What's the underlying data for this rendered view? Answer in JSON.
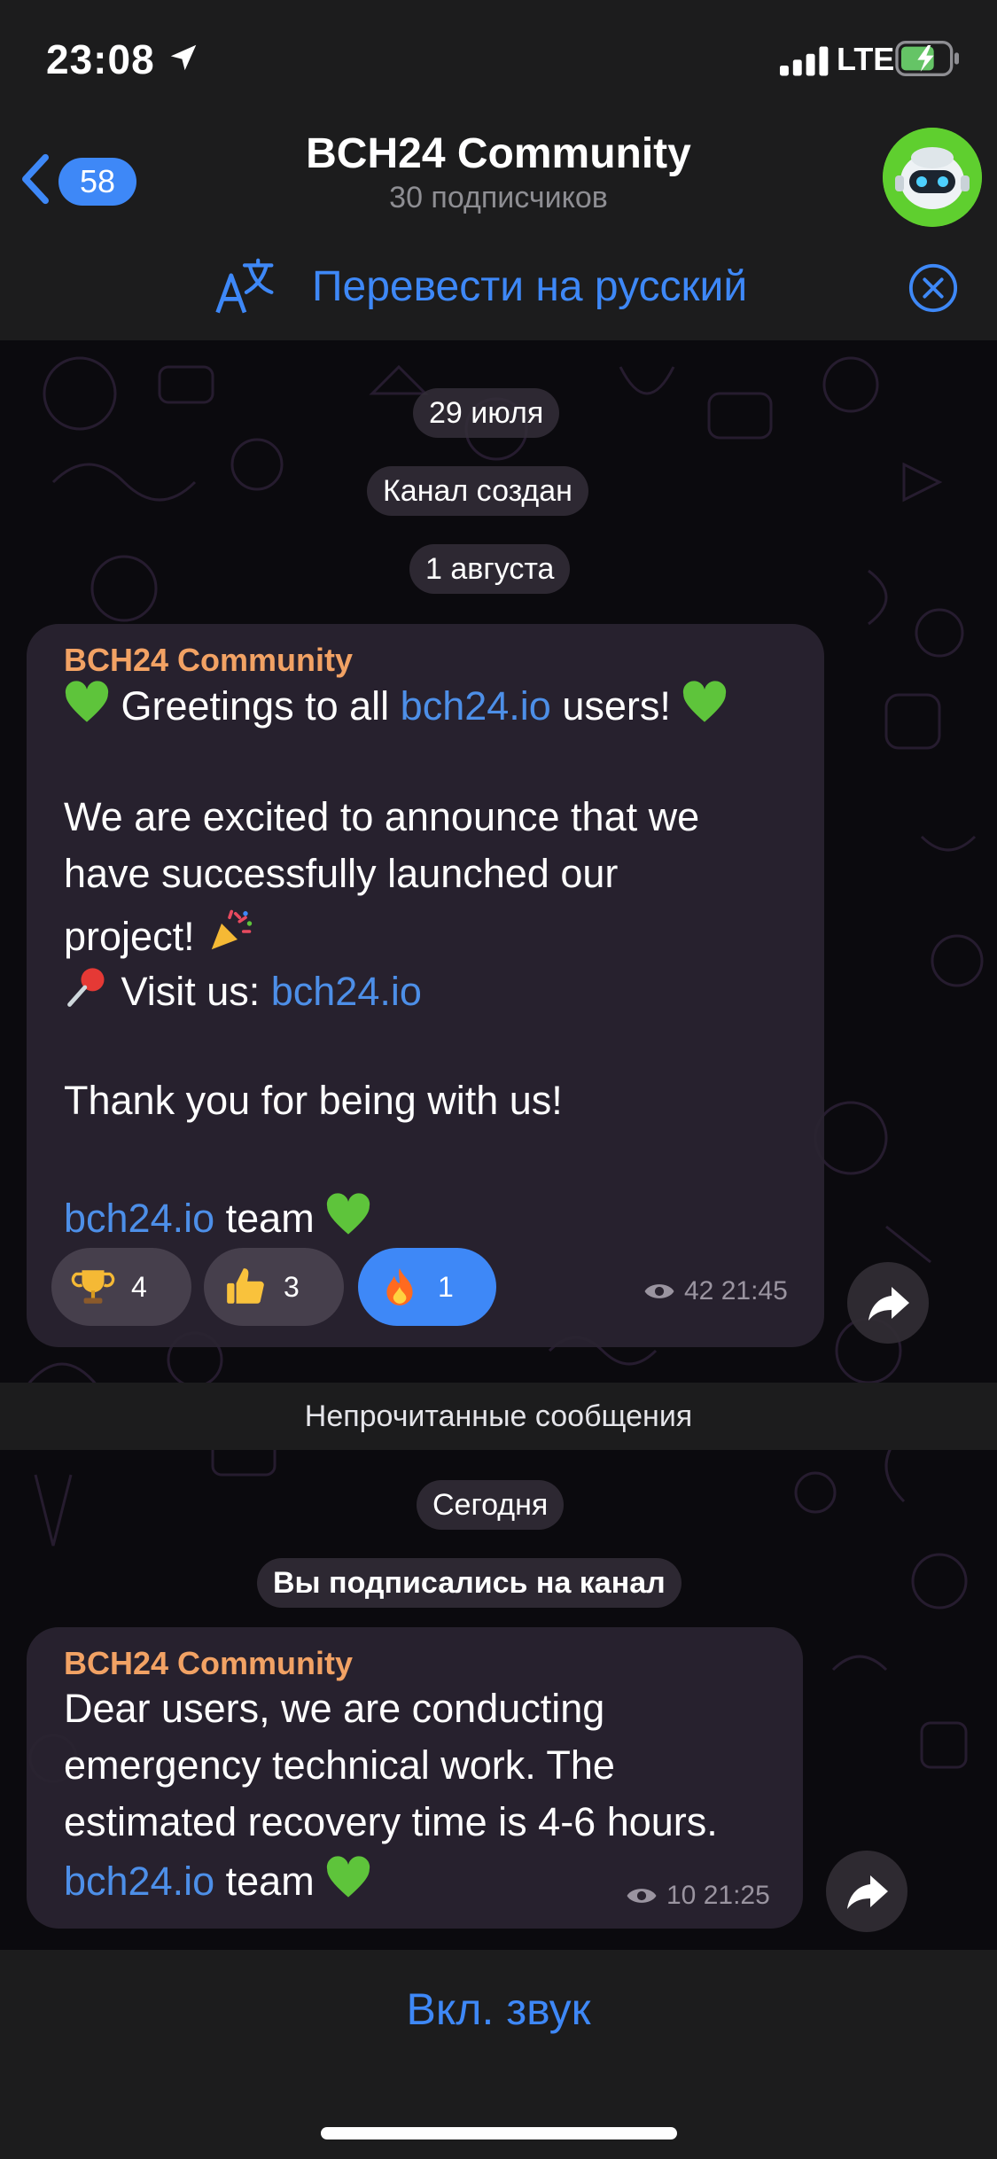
{
  "status_bar": {
    "time": "23:08",
    "network": "LTE"
  },
  "header": {
    "back_count": "58",
    "title": "BCH24 Community",
    "subtitle": "30 подписчиков"
  },
  "translate_bar": {
    "label": "Перевести на русский"
  },
  "chat": {
    "date1": "29 июля",
    "service1": "Канал создан",
    "date2": "1 августа",
    "message1": {
      "author": "BCH24 Community",
      "line1_pre": "Greetings to all ",
      "line1_link": "bch24.io",
      "line1_post": " users!",
      "line2": "We are excited to announce that we",
      "line3": "have successfully launched our",
      "line4": "project!",
      "line5_pre": "Visit us: ",
      "line5_link": "bch24.io",
      "line6": "Thank you for being with us!",
      "line7_link": "bch24.io",
      "line7_post": " team",
      "reactions": [
        {
          "icon": "trophy",
          "count": "4",
          "active": false
        },
        {
          "icon": "thumbs-up",
          "count": "3",
          "active": false
        },
        {
          "icon": "fire",
          "count": "1",
          "active": true
        }
      ],
      "views": "42",
      "time": "21:45"
    },
    "unread_label": "Непрочитанные сообщения",
    "date3": "Сегодня",
    "service2": "Вы подписались на канал",
    "message2": {
      "author": "BCH24 Community",
      "line1": "Dear users, we are conducting",
      "line2": "emergency technical work. The",
      "line3": "estimated recovery time is 4-6 hours.",
      "line4_link": "bch24.io",
      "line4_post": " team",
      "views": "10",
      "time": "21:25"
    }
  },
  "bottom_bar": {
    "sound_label": "Вкл. звук"
  },
  "colors": {
    "accent": "#3e88f7",
    "author": "#f2a264",
    "link": "#4d8fe8",
    "bar_bg": "#1c1c1d"
  }
}
